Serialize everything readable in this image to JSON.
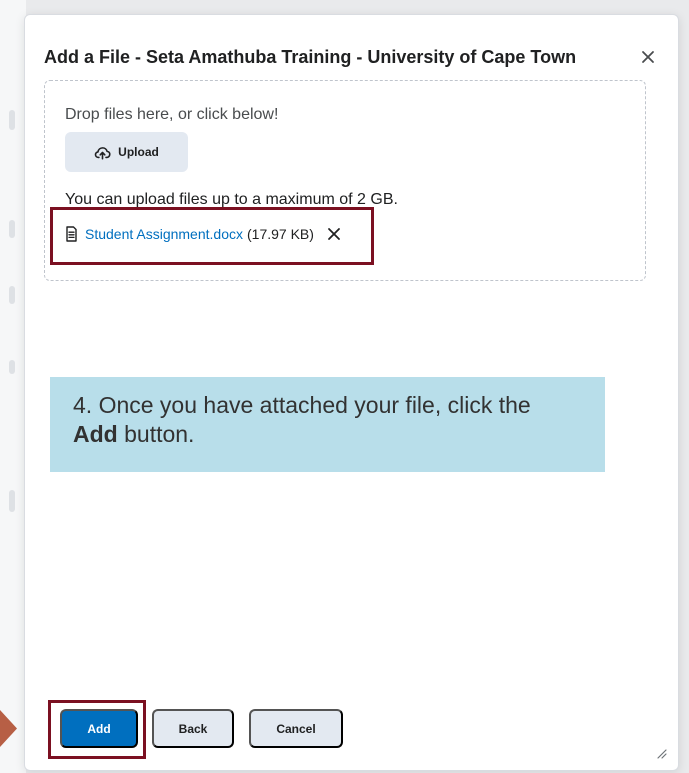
{
  "dialog": {
    "title": "Add a File - Seta Amathuba Training - University of Cape Town",
    "close_icon": "close-icon"
  },
  "upload_area": {
    "drop_text": "Drop files here, or click below!",
    "upload_label": "Upload",
    "upload_icon": "cloud-upload-icon",
    "limit_text": "You can upload files up to a maximum of 2 GB.",
    "files": [
      {
        "name": "Student Assignment.docx",
        "size": "(17.97 KB)",
        "icon": "document-icon",
        "remove_icon": "remove-file-icon"
      }
    ]
  },
  "callout": {
    "prefix": "4. Once you have attached your file, click the ",
    "emphasis": "Add",
    "suffix": " button."
  },
  "footer": {
    "add_label": "Add",
    "back_label": "Back",
    "cancel_label": "Cancel",
    "resize_icon": "resize-handle-icon"
  },
  "colors": {
    "primary_button": "#006fbf",
    "secondary_button": "#e3e9f1",
    "highlight_border": "#7b1021",
    "callout_background": "#b8deea",
    "link": "#006fbf"
  }
}
